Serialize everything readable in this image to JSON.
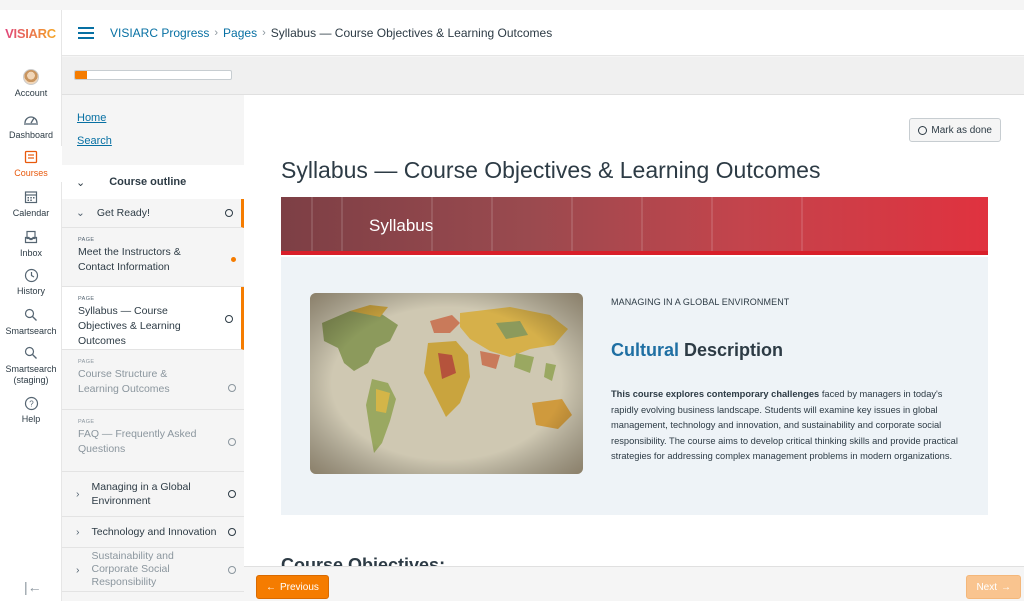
{
  "brand": {
    "logo_text": "VISIARC"
  },
  "global_nav": [
    {
      "label": "Account",
      "icon": "avatar"
    },
    {
      "label": "Dashboard",
      "icon": "dashboard-icon"
    },
    {
      "label": "Courses",
      "icon": "courses-icon",
      "active": true
    },
    {
      "label": "Calendar",
      "icon": "calendar-icon"
    },
    {
      "label": "Inbox",
      "icon": "inbox-icon"
    },
    {
      "label": "History",
      "icon": "history-icon"
    },
    {
      "label": "Smartsearch",
      "icon": "search-icon"
    },
    {
      "label": "Smartsearch (staging)",
      "icon": "search-icon"
    },
    {
      "label": "Help",
      "icon": "help-icon"
    }
  ],
  "breadcrumb": {
    "course": "VISIARC Progress",
    "section": "Pages",
    "current": "Syllabus — Course Objectives & Learning Outcomes",
    "separator": "›"
  },
  "progress": {
    "fraction": 0.08,
    "color": "#f57c00"
  },
  "course_nav": {
    "home": "Home",
    "search": "Search",
    "outline_label": "Course outline",
    "items": [
      {
        "type": "module",
        "title": "Get Ready!"
      },
      {
        "type": "page",
        "tag": "PAGE",
        "title": "Meet the Instructors & Contact Information",
        "status": "dot"
      },
      {
        "type": "page",
        "tag": "PAGE",
        "title": "Syllabus — Course Objectives & Learning Outcomes",
        "current": true
      },
      {
        "type": "page",
        "tag": "PAGE",
        "title": "Course Structure & Learning Outcomes",
        "dim": true
      },
      {
        "type": "page",
        "tag": "PAGE",
        "title": "FAQ — Frequently Asked Questions",
        "dim": true
      },
      {
        "type": "module",
        "title": "Managing in a Global Environment"
      },
      {
        "type": "module",
        "title": "Technology and Innovation"
      },
      {
        "type": "module",
        "title": "Sustainability and Corporate Social Responsibility",
        "dim": true
      }
    ]
  },
  "main": {
    "mark_done": "Mark as done",
    "title": "Syllabus — Course Objectives & Learning Outcomes",
    "banner_title": "Syllabus",
    "subtitle": "MANAGING IN A GLOBAL ENVIRONMENT",
    "cultural_hl": "Cultural",
    "cultural_rest": " Description",
    "desc_bold": "This course explores contemporary challenges",
    "desc_rest": " faced by managers in today's rapidly evolving business landscape. Students will examine key issues in global management, technology and innovation, and sustainability and corporate social responsibility. The course aims to develop critical thinking skills and provide practical strategies for addressing complex management problems in modern organizations.",
    "course_objectives": "Course Objectives:"
  },
  "footer": {
    "prev": "Previous",
    "next": "Next"
  },
  "colors": {
    "accent": "#f57c00",
    "link": "#0770a3",
    "banner_red": "#d81f2a",
    "heading_blue": "#1f6fa3"
  }
}
